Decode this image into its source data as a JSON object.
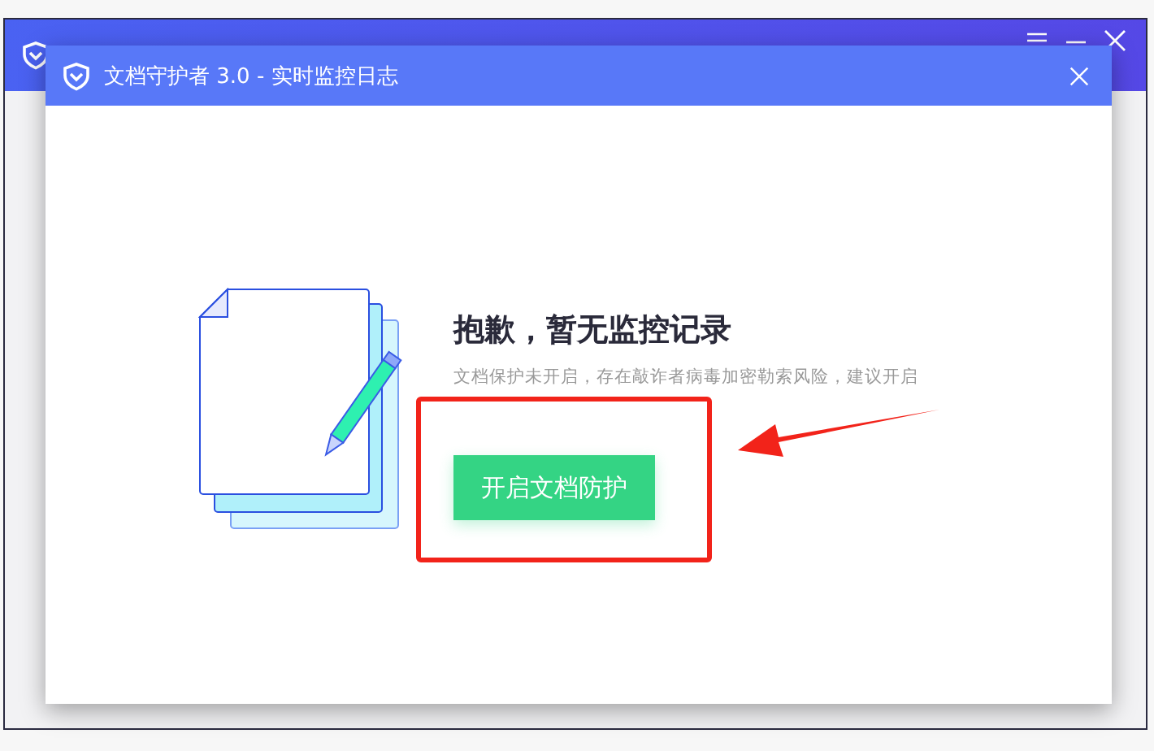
{
  "dialog": {
    "title": "文档守护者 3.0 - 实时监控日志",
    "heading": "抱歉，暂无监控记录",
    "message": "文档保护未开启，存在敲诈者病毒加密勒索风险，建议开启",
    "button": "开启文档防护"
  }
}
